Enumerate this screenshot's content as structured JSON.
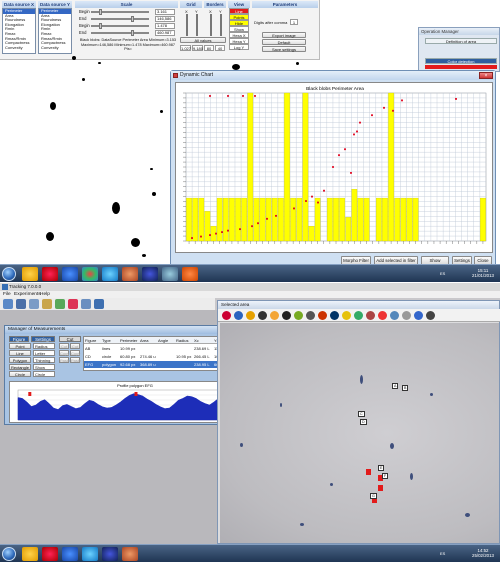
{
  "top": {
    "data_source_x": {
      "header": "Data source X",
      "items": [
        "Perimeter",
        "Area",
        "Roundness",
        "Elongation",
        "Rmin",
        "Rmax",
        "Rmax/Rmin",
        "Compactness",
        "Convexity"
      ],
      "selected": 0
    },
    "data_source_y": {
      "header": "Data source Y",
      "items": [
        "Perimeter",
        "Area",
        "Roundness",
        "Elongation",
        "Rmin",
        "Rmax",
        "Rmax/Rmin",
        "Compactness",
        "Convexity"
      ],
      "selected": 0
    },
    "scale": {
      "header": "Scale",
      "rows": [
        {
          "label": "Begin",
          "value": "3.161"
        },
        {
          "label": "End",
          "value": "146,586"
        },
        {
          "label": "Begin",
          "value": "1.478"
        },
        {
          "label": "End",
          "value": "460.987"
        }
      ],
      "info_line1": "Black blobs: DataSource Perimeter Area Minimum=3.153",
      "info_line2": "Maximum=146,586 Minimum=1.478 Maximum=460.987 Pts="
    },
    "grid": {
      "header": "Grid",
      "x_label": "X",
      "y_label": "Y"
    },
    "borders": {
      "header": "Borders",
      "x_label": "X",
      "y_label": "Y"
    },
    "all_values_label": "All values",
    "small_values": [
      "1.027",
      "9.180",
      "80",
      "40"
    ],
    "view": {
      "header": "View",
      "items": [
        "Line",
        "Points",
        "Hide",
        "Show",
        "Hexa X",
        "Hexa Y",
        "Log Y"
      ]
    },
    "parameters": {
      "header": "Parameters",
      "digits_label": "Digits after comma",
      "digits_value": "1",
      "export_image": "Export image",
      "default": "Default",
      "save_settings": "Save settings"
    },
    "operation_manager": {
      "title": "Operation Manager",
      "tab1": "Definition of area",
      "tab2": "Color detection"
    }
  },
  "dynamic_chart": {
    "title": "Dynamic Chart",
    "buttons": [
      "Morpho Filter",
      "Add selected in filter",
      "Show selected",
      "Settings",
      "Close"
    ]
  },
  "chart_data": {
    "type": "bar",
    "title": "Black blobs Perimeter Area",
    "grid": true,
    "bar_color": "#ffff00",
    "x_label_count": 49,
    "bar_heights_fraction": [
      0.29,
      0.29,
      0.29,
      0.2,
      0.1,
      0.29,
      0.29,
      0.29,
      0.29,
      0.29,
      1.0,
      0.29,
      0.29,
      0.29,
      0.29,
      0.29,
      1.0,
      0.29,
      0.29,
      1.0,
      0.1,
      0.29,
      0.0,
      0.29,
      0.29,
      0.29,
      0.16,
      0.35,
      0.29,
      0.29,
      0.0,
      0.29,
      0.29,
      1.0,
      0.29,
      0.29,
      0.29,
      0.29,
      0.0,
      0.0,
      0.0,
      0.0,
      0.0,
      0.0,
      0.0,
      0.0,
      0.0,
      0.0,
      0.29
    ],
    "points_fraction": [
      [
        0.02,
        0.02
      ],
      [
        0.05,
        0.03
      ],
      [
        0.08,
        0.04
      ],
      [
        0.1,
        0.05
      ],
      [
        0.12,
        0.06
      ],
      [
        0.14,
        0.07
      ],
      [
        0.18,
        0.08
      ],
      [
        0.22,
        0.1
      ],
      [
        0.24,
        0.12
      ],
      [
        0.27,
        0.15
      ],
      [
        0.3,
        0.17
      ],
      [
        0.36,
        0.22
      ],
      [
        0.4,
        0.27
      ],
      [
        0.42,
        0.3
      ],
      [
        0.44,
        0.26
      ],
      [
        0.46,
        0.34
      ],
      [
        0.49,
        0.5
      ],
      [
        0.51,
        0.58
      ],
      [
        0.53,
        0.62
      ],
      [
        0.55,
        0.46
      ],
      [
        0.56,
        0.72
      ],
      [
        0.57,
        0.74
      ],
      [
        0.58,
        0.8
      ],
      [
        0.62,
        0.85
      ],
      [
        0.66,
        0.9
      ],
      [
        0.69,
        0.88
      ],
      [
        0.72,
        0.95
      ],
      [
        0.9,
        0.96
      ],
      [
        0.08,
        0.98
      ],
      [
        0.14,
        0.98
      ],
      [
        0.19,
        0.98
      ],
      [
        0.23,
        0.98
      ]
    ],
    "point_color": "#e0001b"
  },
  "taskbar_top": {
    "clock_time": "15:11",
    "clock_date": "21/01/2013",
    "lang": "ES"
  },
  "bottom": {
    "title": "Tracking 7.0.0.0",
    "menu": [
      "File",
      "Experiments",
      "Help"
    ],
    "manager": {
      "title": "Manager of Measurements",
      "figure_tab": "Figure",
      "settings_tab": "Settings",
      "cut_tab": "Cut",
      "figure_buttons": [
        "Point",
        "Line",
        "Polygon",
        "Rectangle",
        "Circle"
      ],
      "settings_items": [
        "Radius",
        "Letter",
        "Thinning",
        "Show",
        "Circle"
      ],
      "cut_buttons": [
        "Cut",
        "Copy",
        "Paste",
        "Cut",
        "Copy",
        "Paste"
      ],
      "table": {
        "headers": [
          "Figure",
          "Type",
          "Perimeter",
          "Area",
          "Angle",
          "Radius",
          "Xc",
          "Yc"
        ],
        "rows": [
          [
            "AB",
            "lines",
            "10.99 px",
            "",
            "",
            "",
            "238.69 L",
            "11.99 L"
          ],
          [
            "CD",
            "circle",
            "60.80 px",
            "274.46 u",
            "",
            "10.95 px",
            "266.45 L",
            "103.11 L"
          ],
          [
            "EFG",
            "polygon",
            "92.68 px",
            "368.89 u",
            "",
            "",
            "238.95 L",
            "66.35 L"
          ]
        ],
        "selected_row": 2
      },
      "profile_title": "Profile polygon EFG",
      "side_buttons": [
        "Profile",
        "Remove",
        "Remove all",
        "View All",
        "Default",
        "Save Settings"
      ]
    },
    "selected_area": {
      "title": "Selected area",
      "labels": [
        "A",
        "B",
        "C",
        "D",
        "E",
        "F",
        "G"
      ]
    },
    "profile_data": {
      "type": "line",
      "color": "#1d2db8",
      "values": [
        0.75,
        0.72,
        0.6,
        0.45,
        0.5,
        0.62,
        0.68,
        0.55,
        0.4,
        0.35,
        0.48,
        0.52,
        0.45,
        0.38,
        0.42,
        0.55,
        0.66,
        0.62,
        0.52,
        0.44,
        0.4,
        0.42,
        0.5,
        0.6,
        0.72,
        0.82,
        0.88,
        0.85,
        0.8,
        0.7,
        0.62,
        0.52,
        0.44,
        0.38,
        0.4,
        0.52,
        0.66,
        0.72,
        0.8,
        0.78,
        0.72,
        0.62,
        0.55,
        0.5,
        0.6,
        0.72,
        0.8,
        0.82,
        0.78,
        0.72,
        0.66,
        0.62,
        0.7,
        0.74
      ]
    }
  },
  "taskbar_bottom": {
    "clock_time": "14:52",
    "clock_date": "25/02/2013",
    "lang": "ES"
  }
}
